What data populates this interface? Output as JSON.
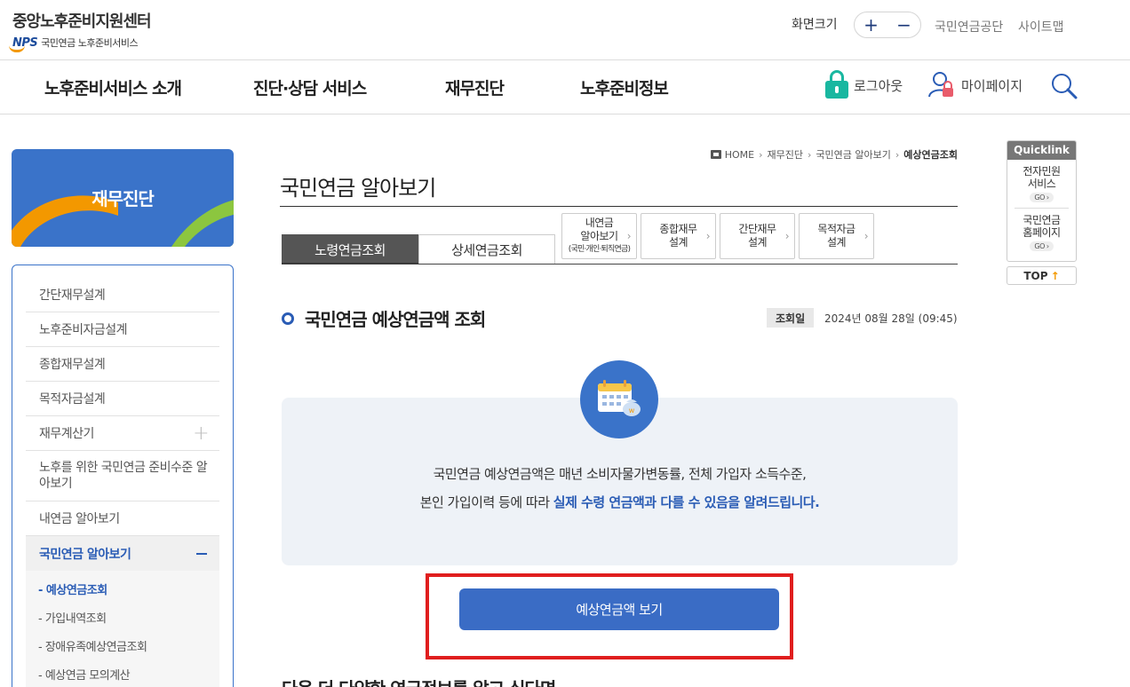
{
  "header": {
    "logo_main": "중앙노후준비지원센터",
    "logo_mark": "NPS",
    "logo_sub": "국민연금 노후준비서비스",
    "font_size_label": "화면크기",
    "font_plus": "+",
    "font_minus": "−",
    "nps_link": "국민연금공단",
    "sitemap_link": "사이트맵"
  },
  "gnb": {
    "items": [
      "노후준비서비스 소개",
      "진단·상담 서비스",
      "재무진단",
      "노후준비정보"
    ],
    "logout": "로그아웃",
    "mypage": "마이페이지"
  },
  "lnb": {
    "banner_title": "재무진단",
    "items": [
      "간단재무설계",
      "노후준비자금설계",
      "종합재무설계",
      "목적자금설계",
      "재무계산기",
      "노후를 위한 국민연금 준비수준 알아보기",
      "내연금 알아보기",
      "국민연금 알아보기"
    ],
    "sub_items": [
      "- 예상연금조회",
      "- 가입내역조회",
      "- 장애유족예상연금조회",
      "- 예상연금 모의계산"
    ]
  },
  "breadcrumb": [
    "HOME",
    "재무진단",
    "국민연금 알아보기",
    "예상연금조회"
  ],
  "page_title": "국민연금 알아보기",
  "tabs": [
    "노령연금조회",
    "상세연금조회"
  ],
  "shortcut_buttons": [
    {
      "line1": "내연금",
      "line2": "알아보기",
      "line3": "(국민·개인·퇴직연금)"
    },
    {
      "line1": "종합재무",
      "line2": "설계"
    },
    {
      "line1": "간단재무",
      "line2": "설계"
    },
    {
      "line1": "목적자금",
      "line2": "설계"
    }
  ],
  "section": {
    "title": "국민연금 예상연금액 조회",
    "date_label": "조회일",
    "date_value": "2024년 08월 28일 (09:45)"
  },
  "info": {
    "line1": "국민연금 예상연금액은 매년 소비자물가변동률, 전체 가입자 소득수준,",
    "line2_prefix": "본인 가입이력 등에 따라 ",
    "line2_highlight": "실제 수령 연금액과 다를 수 있음을 알려드립니다."
  },
  "main_button": "예상연금액 보기",
  "bottom_title": "다음 더 다양한 연금정보를 알고 싶다면",
  "quicklink": {
    "head": "Quicklink",
    "item1": "전자민원 서비스",
    "item2": "국민연금 홈페이지",
    "go": "GO ›",
    "top": "TOP",
    "top_arrow": "↑"
  },
  "colors": {
    "brand_blue": "#3a73c9",
    "highlight_blue": "#2a5cb5",
    "lock_green": "#19b7a0",
    "accent_orange": "#f39800",
    "alert_red": "#e01e1e"
  }
}
